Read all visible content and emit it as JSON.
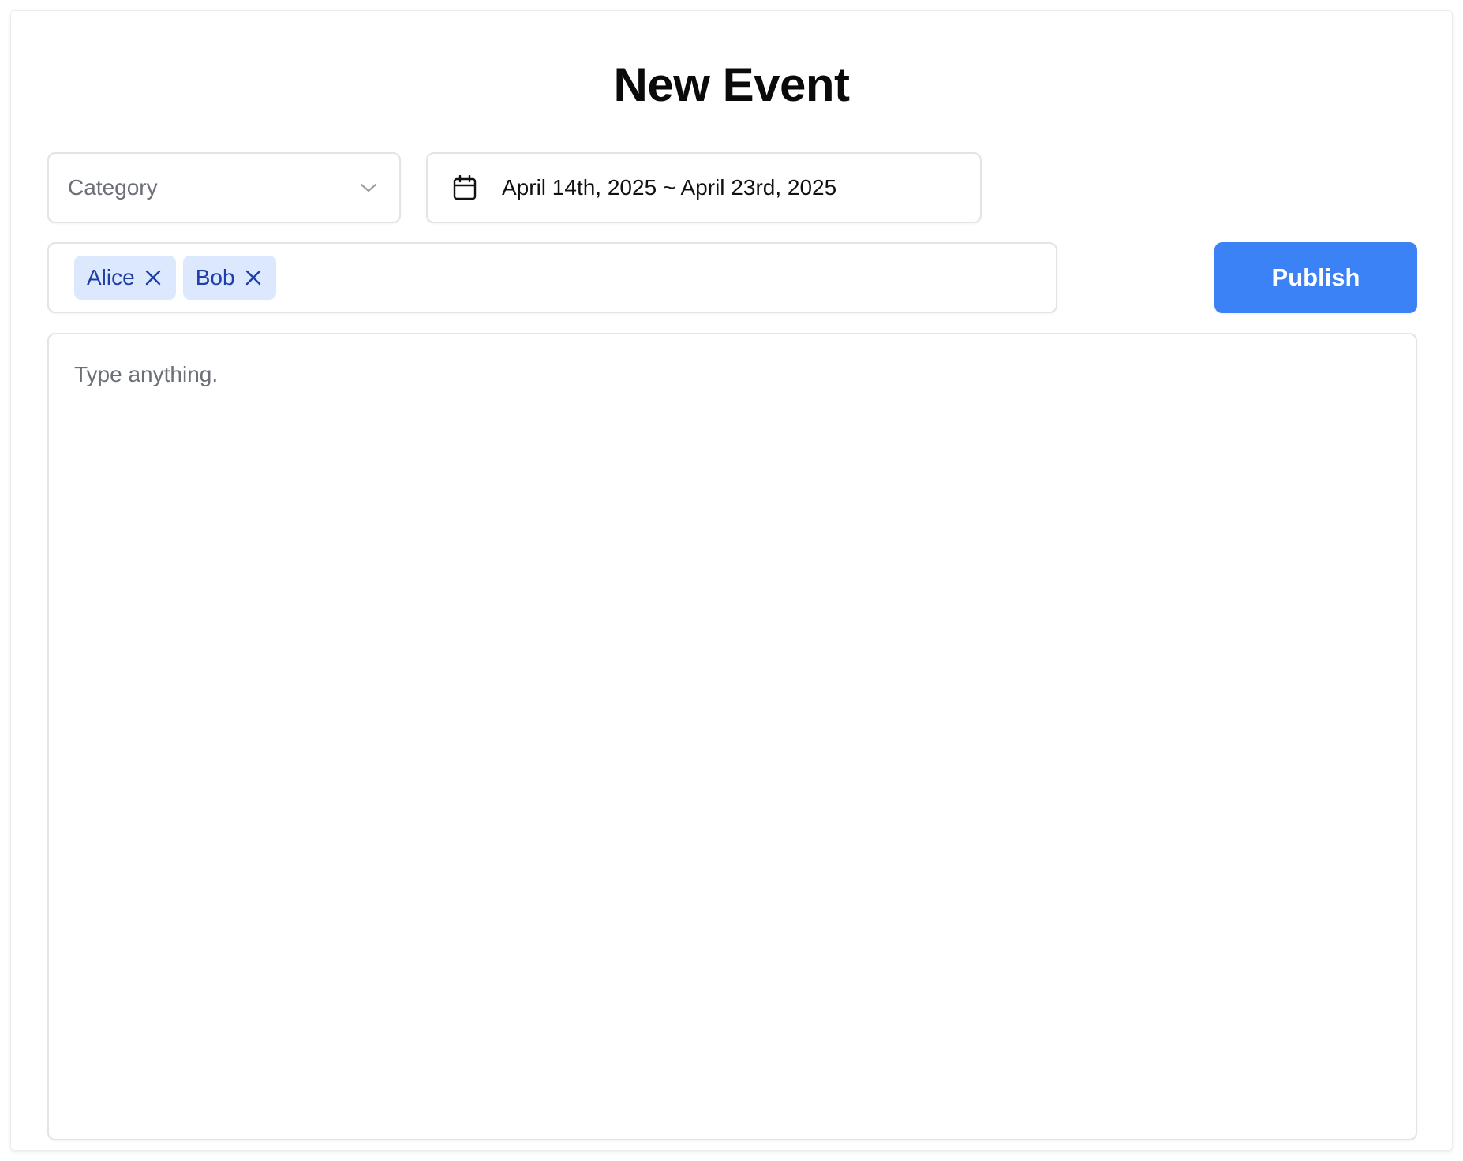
{
  "page": {
    "title": "New Event"
  },
  "category_select": {
    "placeholder": "Category",
    "icon": "chevron-down-icon"
  },
  "date_range": {
    "icon": "calendar-icon",
    "value": "April 14th, 2025 ~ April 23rd, 2025"
  },
  "attendees": {
    "tags": [
      {
        "label": "Alice"
      },
      {
        "label": "Bob"
      }
    ],
    "remove_icon": "close-icon"
  },
  "actions": {
    "publish_label": "Publish"
  },
  "editor": {
    "placeholder": "Type anything."
  },
  "colors": {
    "accent": "#3b82f6",
    "tag_background": "#dbe8fe",
    "tag_text": "#1e3fa8",
    "placeholder_text": "#6b6f78",
    "border": "#e3e4e8"
  }
}
